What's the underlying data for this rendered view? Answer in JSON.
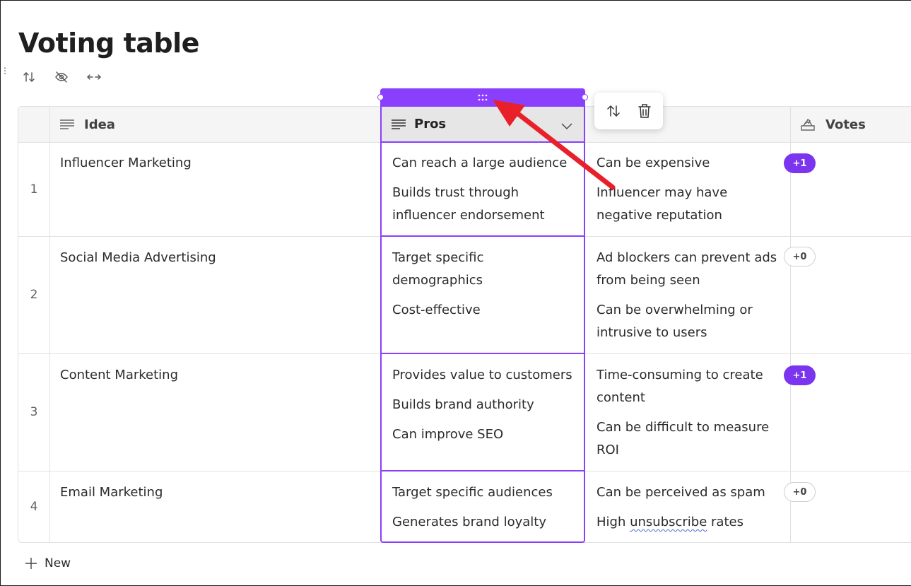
{
  "page": {
    "title": "Voting table"
  },
  "toolbar": {
    "icons": [
      "sort-icon",
      "hide-icon",
      "width-icon"
    ]
  },
  "columns": {
    "idea": {
      "label": "Idea",
      "icon": "text-lines-icon"
    },
    "pros": {
      "label": "Pros",
      "icon": "text-lines-icon"
    },
    "votes": {
      "label": "Votes",
      "icon": "vote-box-icon"
    }
  },
  "rows": [
    {
      "num": "1",
      "idea": "Influencer Marketing",
      "pros": [
        "Can reach a large audience",
        "Builds trust through influencer endorsement"
      ],
      "cons": [
        "Can be expensive",
        "Influencer may have negative reputation"
      ],
      "vote": "+1",
      "voted": true
    },
    {
      "num": "2",
      "idea": "Social Media Advertising",
      "pros": [
        "Target specific demographics",
        "Cost-effective"
      ],
      "cons": [
        "Ad blockers can prevent ads from being seen",
        "Can be overwhelming or intrusive to users"
      ],
      "vote": "+0",
      "voted": false
    },
    {
      "num": "3",
      "idea": "Content Marketing",
      "pros": [
        "Provides value to customers",
        "Builds brand authority",
        "Can improve SEO"
      ],
      "cons": [
        "Time-consuming to create content",
        "Can be difficult to measure ROI"
      ],
      "vote": "+1",
      "voted": true
    },
    {
      "num": "4",
      "idea": "Email Marketing",
      "pros": [
        "Target specific audiences",
        "Generates brand loyalty"
      ],
      "cons": [
        "Can be perceived as spam"
      ],
      "cons_last": {
        "before": "High ",
        "underlined": "unsubscribe",
        "after": " rates"
      },
      "vote": "+0",
      "voted": false
    }
  ],
  "footer": {
    "new_label": "New"
  },
  "colors": {
    "accent": "#8a3ffc",
    "vote_on": "#7b35ee",
    "arrow": "#e8202a"
  }
}
